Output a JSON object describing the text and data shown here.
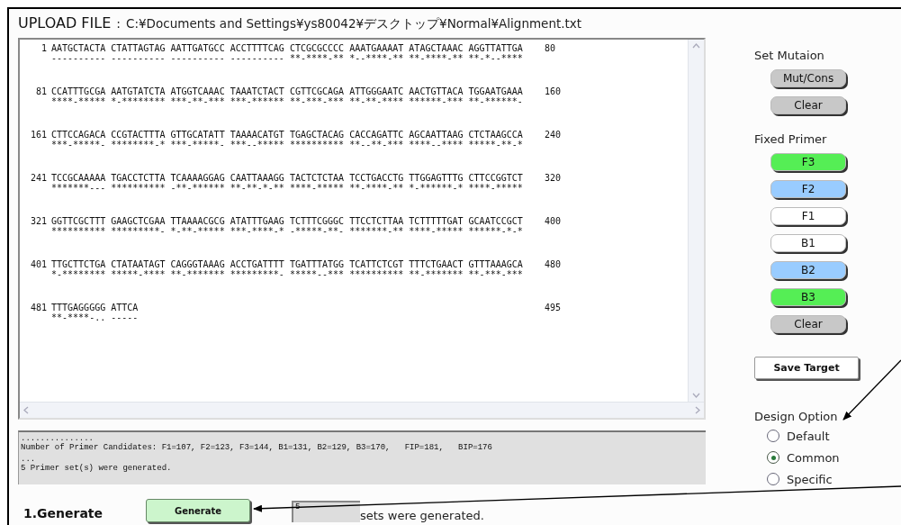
{
  "title": {
    "label": "UPLOAD FILE",
    "separator": ":",
    "path": "C:¥Documents and Settings¥ys80042¥デスクトップ¥Normal¥Alignment.txt"
  },
  "alignment": [
    {
      "start": "1",
      "sequence": "AATGCTACTA CTATTAGTAG AATTGATGCC ACCTTTTCAG CTCGCGCCCC AAATGAAAAT ATAGCTAAAC AGGTTATTGA",
      "end": "80",
      "consensus": "---------- ---------- ---------- ---------- **-****-** *--****-** **-****-** **-*--****"
    },
    {
      "start": "81",
      "sequence": "CCATTTGCGA AATGTATCTA ATGGTCAAAC TAAATCTACT CGTTCGCAGA ATTGGGAATC AACTGTTACA TGGAATGAAA",
      "end": "160",
      "consensus": "****-***** *-******** ***-**-*** ***-****** **-***-*** **-**-**** ******-*** **-******-"
    },
    {
      "start": "161",
      "sequence": "CTTCCAGACA CCGTACTTTA GTTGCATATT TAAAACATGT TGAGCTACAG CACCAGATTC AGCAATTAAG CTCTAAGCCA",
      "end": "240",
      "consensus": "***-*****- ********-* ***-*****- ***--***** ********** **--**-*** ****--**** *****-**-*"
    },
    {
      "start": "241",
      "sequence": "TCCGCAAAAA TGACCTCTTA TCAAAAGGAG CAATTAAAGG TACTCTCTAA TCCTGACCTG TTGGAGTTTG CTTCCGGTCT",
      "end": "320",
      "consensus": "*******--- ********** -**-****** **-**-*-** ****-***** **-****-** *-******-* ****-*****"
    },
    {
      "start": "321",
      "sequence": "GGTTCGCTTT GAAGCTCGAA TTAAAACGCG ATATTTGAAG TCTTTCGGGC TTCCTCTTAA TCTTTTTGAT GCAATCCGCT",
      "end": "400",
      "consensus": "********** *********- *-**-***** ***-****-* -*****-**- *******-** ****-***** ******-*-*"
    },
    {
      "start": "401",
      "sequence": "TTGCTTCTGA CTATAATAGT CAGGGTAAAG ACCTGATTTT TGATTTATGG TCATTCTCGT TTTCTGAACT GTTTAAAGCA",
      "end": "480",
      "consensus": "*-******** *****-**** **-******* *********- *****--*** ********** **-******* **-***-***"
    },
    {
      "start": "481",
      "sequence": "TTTGAGGGGG ATTCA",
      "end": "495",
      "consensus": "**-****-.. -----"
    }
  ],
  "output": [
    "...............",
    "Number of Primer Candidates: F1=107, F2=123, F3=144, B1=131, B2=129, B3=170,   FIP=181,   BIP=176",
    "...",
    "5 Primer set(s) were generated."
  ],
  "set_mutation": {
    "heading": "Set Mutaion",
    "buttons": [
      {
        "label": "Mut/Cons",
        "color": "#c8c8c8"
      },
      {
        "label": "Clear",
        "color": "#c8c8c8"
      }
    ]
  },
  "fixed_primer": {
    "heading": "Fixed Primer",
    "buttons": [
      {
        "label": "F3",
        "color": "#55ee55"
      },
      {
        "label": "F2",
        "color": "#99ccff"
      },
      {
        "label": "F1",
        "color": "#ffffff"
      },
      {
        "label": "B1",
        "color": "#ffffff"
      },
      {
        "label": "B2",
        "color": "#99ccff"
      },
      {
        "label": "B3",
        "color": "#55ee55"
      },
      {
        "label": "Clear",
        "color": "#c8c8c8"
      }
    ]
  },
  "save_target": {
    "label": "Save Target"
  },
  "design_option": {
    "heading": "Design Option",
    "options": [
      {
        "label": "Default",
        "selected": false
      },
      {
        "label": "Common",
        "selected": true
      },
      {
        "label": "Specific",
        "selected": false
      }
    ]
  },
  "generate": {
    "step": "1.Generate",
    "button": "Generate",
    "count": "5",
    "message": "sets were generated."
  }
}
